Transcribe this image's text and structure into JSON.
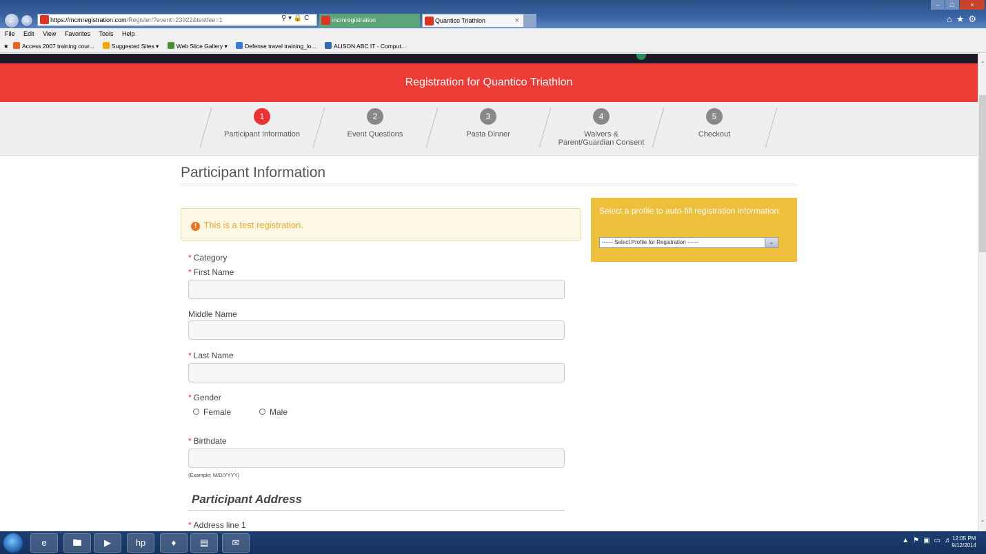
{
  "browser": {
    "address_host": "https://mcmregistration.com",
    "address_path": "/Register/?event=23922&testfee=1",
    "tabs": [
      {
        "label": "mcmregistration"
      },
      {
        "label": "Quantico Triathlon"
      }
    ],
    "menu": [
      "File",
      "Edit",
      "View",
      "Favorites",
      "Tools",
      "Help"
    ],
    "favorites": [
      {
        "label": "Access 2007 training cour...",
        "color": "#e8621c"
      },
      {
        "label": "Suggested Sites ▾",
        "color": "#f2a900"
      },
      {
        "label": "Web Slice Gallery ▾",
        "color": "#4a8f2f"
      },
      {
        "label": "Defense travel training_lo...",
        "color": "#3a7bd5"
      },
      {
        "label": "ALISON ABC IT - Comput...",
        "color": "#2d6db5"
      }
    ]
  },
  "page": {
    "banner_title": "Registration for Quantico Triathlon",
    "steps": [
      {
        "num": "1",
        "label": "Participant Information",
        "active": true
      },
      {
        "num": "2",
        "label": "Event Questions",
        "active": false
      },
      {
        "num": "3",
        "label": "Pasta Dinner",
        "active": false
      },
      {
        "num": "4",
        "label": "Waivers & Parent/Guardian Consent",
        "active": false
      },
      {
        "num": "5",
        "label": "Checkout",
        "active": false
      }
    ],
    "section_title": "Participant Information",
    "alert_text": "This is a test registration.",
    "profile": {
      "prompt": "Select a profile to auto-fill registration information:",
      "select_value": "------ Select Profile for Registration ------"
    },
    "form": {
      "category_label": "Category",
      "first_name_label": "First Name",
      "middle_name_label": "Middle Name",
      "last_name_label": "Last Name",
      "gender_label": "Gender",
      "gender_options": [
        "Female",
        "Male"
      ],
      "birthdate_label": "Birthdate",
      "birthdate_hint": "(Example: M/D/YYYY)",
      "address_heading": "Participant Address",
      "address1_label": "Address line 1"
    }
  },
  "taskbar": {
    "time": "12:05 PM",
    "date": "9/12/2014"
  },
  "colors": {
    "brand_red": "#ef3b35",
    "profile_yellow": "#eebf3b",
    "step_active": "#ee3133"
  }
}
